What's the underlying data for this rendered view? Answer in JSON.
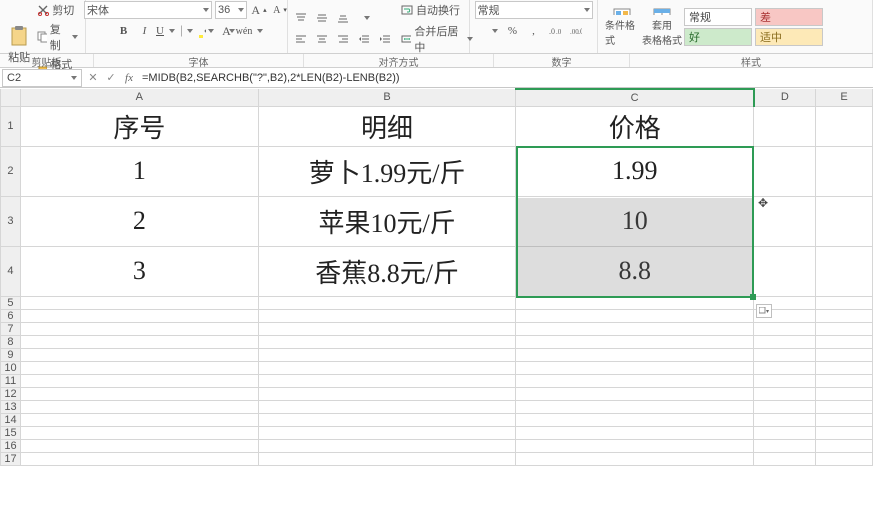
{
  "ribbon": {
    "clipboard": {
      "paste": "粘贴",
      "cut": "剪切",
      "copy": "复制",
      "format_painter": "格式刷",
      "label": "剪贴板"
    },
    "font": {
      "name": "宋体",
      "size": "36",
      "label": "字体"
    },
    "align": {
      "wrap": "自动换行",
      "merge": "合并后居中",
      "label": "对齐方式"
    },
    "number": {
      "format": "常规",
      "label": "数字"
    },
    "styles": {
      "cond": "条件格式",
      "table": "套用\n表格格式",
      "normal": "常规",
      "bad": "差",
      "good": "好",
      "neutral": "适中",
      "label": "样式"
    }
  },
  "formula_bar": {
    "cell_ref": "C2",
    "formula": "=MIDB(B2,SEARCHB(\"?\",B2),2*LEN(B2)-LENB(B2))"
  },
  "columns": [
    "A",
    "B",
    "C",
    "D",
    "E"
  ],
  "row_numbers": [
    "1",
    "2",
    "3",
    "4",
    "5",
    "6",
    "7",
    "8",
    "9",
    "10",
    "11",
    "12",
    "13",
    "14",
    "15",
    "16",
    "17"
  ],
  "chart_data": {
    "type": "table",
    "headers": [
      "序号",
      "明细",
      "价格"
    ],
    "rows": [
      [
        "1",
        "萝卜1.99元/斤",
        "1.99"
      ],
      [
        "2",
        "苹果10元/斤",
        "10"
      ],
      [
        "3",
        "香蕉8.8元/斤",
        "8.8"
      ]
    ]
  }
}
